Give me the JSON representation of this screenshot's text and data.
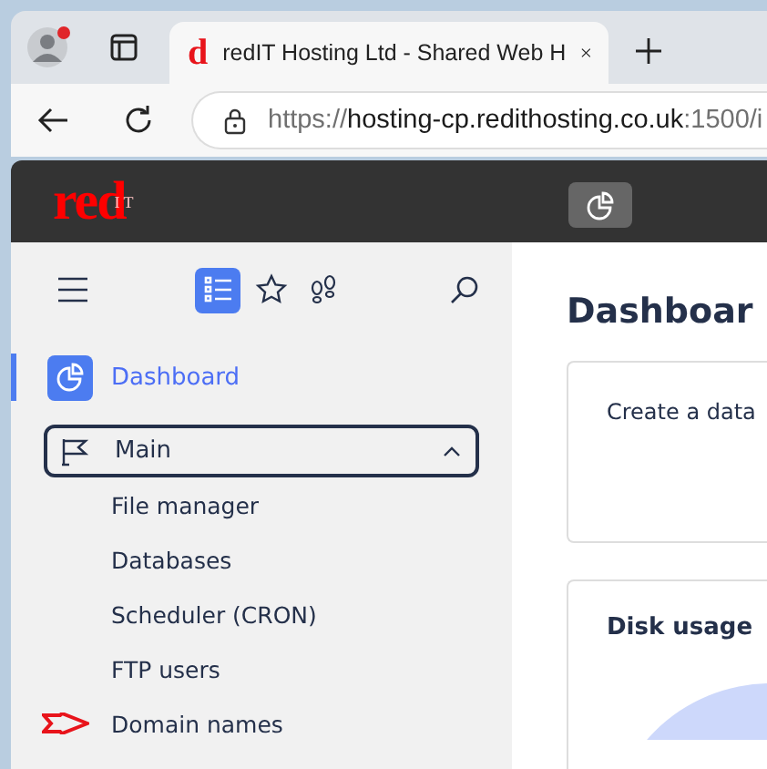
{
  "browser": {
    "tab": {
      "favicon": "d",
      "title": "redIT Hosting Ltd - Shared Web H"
    },
    "url": {
      "scheme": "https://",
      "host": "hosting-cp.redithosting.co.uk",
      "rest": ":1500/i"
    }
  },
  "header": {
    "logo": "red",
    "logo_sub": "IT"
  },
  "sidebar": {
    "tabs": [
      {
        "kind": "list",
        "selected": true
      },
      {
        "kind": "star",
        "selected": false
      },
      {
        "kind": "steps",
        "selected": false
      }
    ],
    "dashboard": {
      "label": "Dashboard",
      "selected": true
    },
    "group": {
      "label": "Main",
      "expanded": true,
      "items": [
        {
          "label": "File manager",
          "marked": false
        },
        {
          "label": "Databases",
          "marked": false
        },
        {
          "label": "Scheduler (CRON)",
          "marked": false
        },
        {
          "label": "FTP users",
          "marked": false
        },
        {
          "label": "Domain names",
          "marked": true
        }
      ]
    }
  },
  "main": {
    "title": "Dashboar",
    "cards": [
      {
        "kind": "text",
        "text": "Create a data"
      },
      {
        "kind": "chart",
        "title": "Disk usage"
      }
    ]
  }
}
